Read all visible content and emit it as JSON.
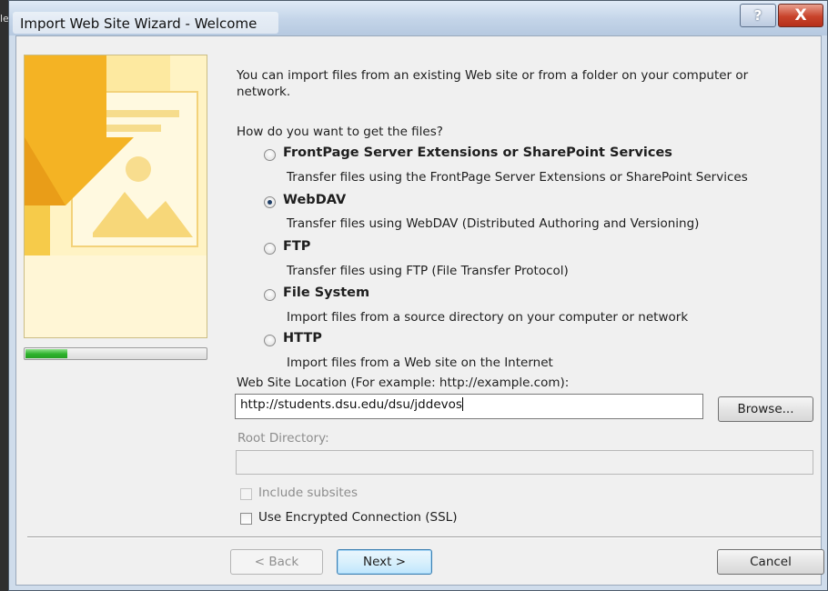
{
  "window": {
    "title": "Import Web Site Wizard - Welcome",
    "help_glyph": "?",
    "close_glyph": "X"
  },
  "background_edge_text": "le",
  "wizard": {
    "intro": "You can import files from an existing Web site or from a folder on your computer or network.",
    "intro_line1": "You can import files from an existing Web site or from a folder on your computer or",
    "intro_line2": "network.",
    "question": "How do you want to get the files?",
    "options": [
      {
        "label": "FrontPage Server Extensions or SharePoint Services",
        "description": "Transfer files using the FrontPage Server Extensions or SharePoint Services",
        "selected": false
      },
      {
        "label": "WebDAV",
        "description": "Transfer files using WebDAV (Distributed Authoring and Versioning)",
        "selected": true
      },
      {
        "label": "FTP",
        "description": "Transfer files using FTP (File Transfer Protocol)",
        "selected": false
      },
      {
        "label": "File System",
        "description": "Import files from a source directory on your computer or network",
        "selected": false
      },
      {
        "label": "HTTP",
        "description": "Import files from a Web site on the Internet",
        "selected": false
      }
    ],
    "progress_fraction": 0.23,
    "location_label": "Web Site Location (For example: http://example.com):",
    "location_value": "http://students.dsu.edu/dsu/jddevos",
    "browse_label": "Browse...",
    "root_label": "Root Directory:",
    "root_value": "",
    "include_subsites_label": "Include subsites",
    "include_subsites_checked": false,
    "ssl_label": "Use Encrypted Connection (SSL)",
    "ssl_checked": false
  },
  "footer": {
    "back_label": "< Back",
    "next_label": "Next >",
    "cancel_label": "Cancel"
  },
  "colors": {
    "accent": "#3c7fb1",
    "art_yellow": "#f7c233",
    "progress_green": "#2db22b"
  }
}
